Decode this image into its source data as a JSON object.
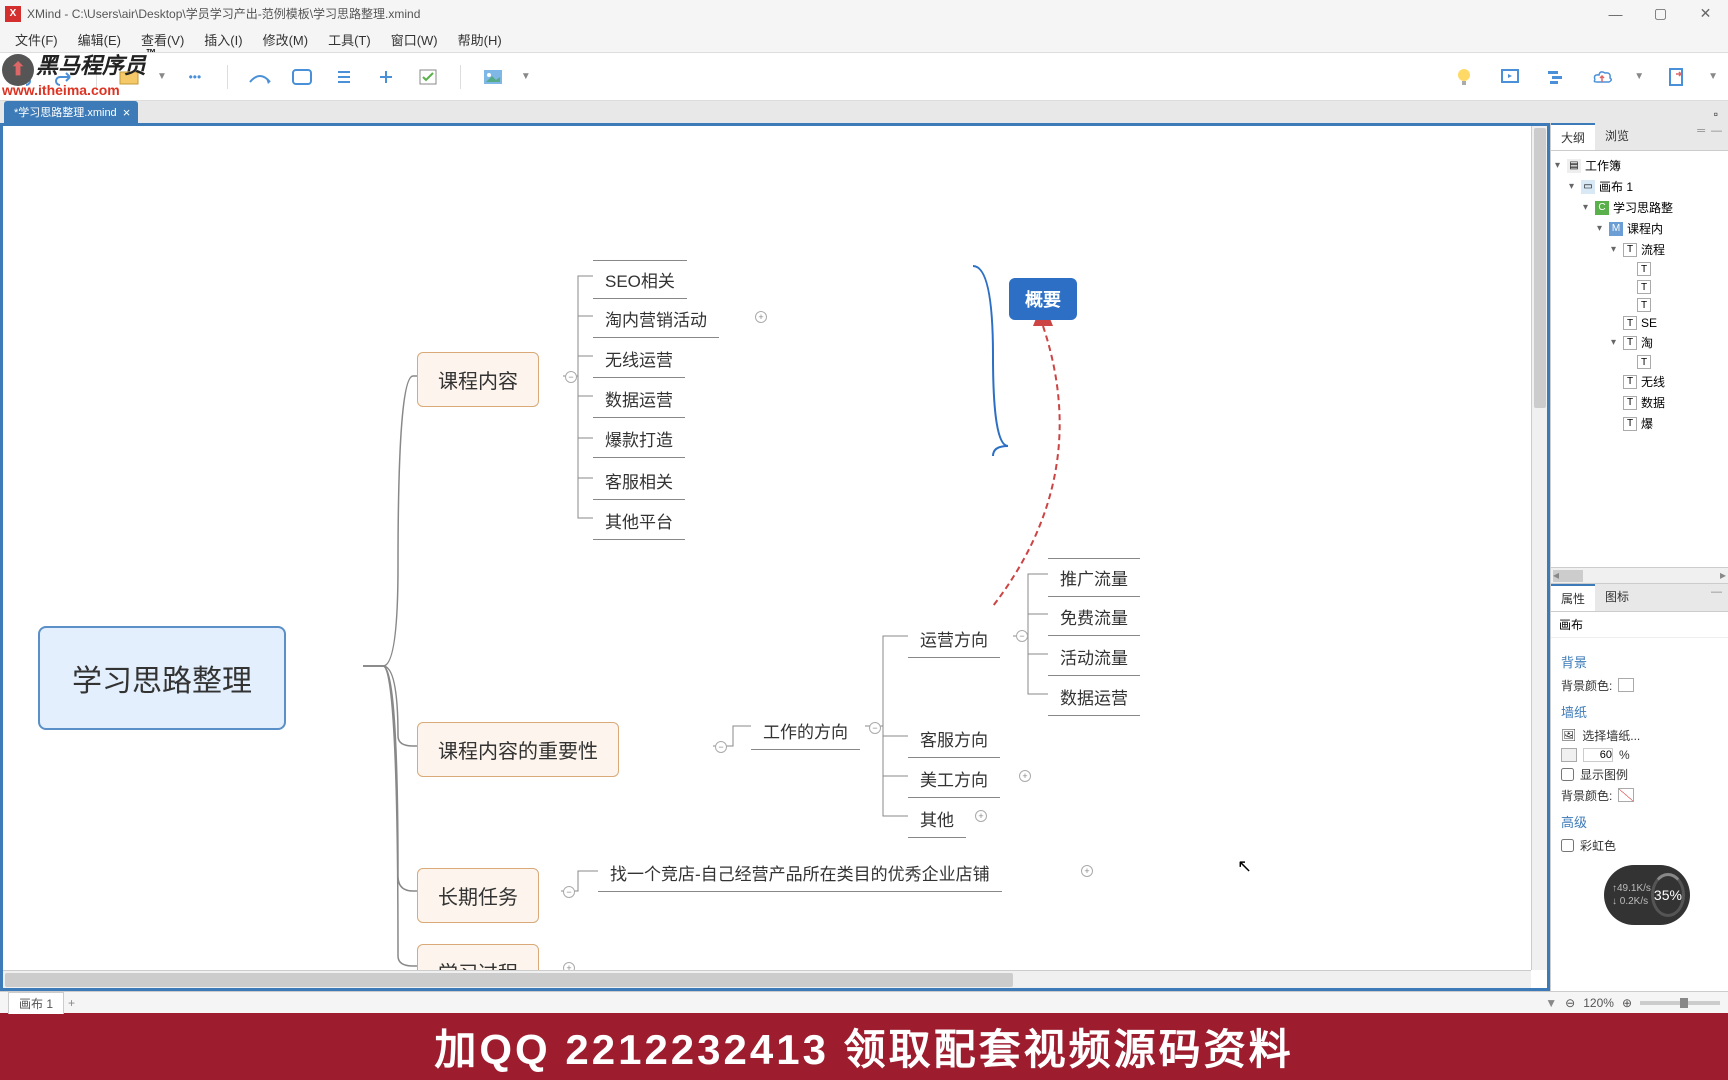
{
  "titlebar": {
    "app": "XMind",
    "path": "C:\\Users\\air\\Desktop\\学员学习产出-范例模板\\学习思路整理.xmind"
  },
  "menubar": [
    "文件(F)",
    "编辑(E)",
    "查看(V)",
    "插入(I)",
    "修改(M)",
    "工具(T)",
    "窗口(W)",
    "帮助(H)"
  ],
  "tab": {
    "label": "*学习思路整理.xmind"
  },
  "logo": {
    "cn": "黑马程序员",
    "url": "www.itheima.com",
    "tm": "™"
  },
  "mindmap": {
    "root": "学习思路整理",
    "summary_label": "概要",
    "topics": {
      "content": {
        "label": "课程内容",
        "children": [
          "SEO相关",
          "淘内营销活动",
          "无线运营",
          "数据运营",
          "爆款打造",
          "客服相关",
          "其他平台"
        ]
      },
      "importance": {
        "label": "课程内容的重要性",
        "work_direction": "工作的方向",
        "dirs": {
          "ops": {
            "label": "运营方向",
            "children": [
              "推广流量",
              "免费流量",
              "活动流量",
              "数据运营"
            ]
          },
          "cs": "客服方向",
          "art": "美工方向",
          "other": "其他"
        }
      },
      "longterm": {
        "label": "长期任务",
        "child": "找一个竞店-自己经营产品所在类目的优秀企业店铺"
      },
      "process": {
        "label": "学习过程"
      }
    }
  },
  "right_panel": {
    "tabs": [
      "大纲",
      "浏览"
    ],
    "tree": {
      "workbook": "工作簿",
      "sheet": "画布 1",
      "root": "学习思路整",
      "course": "课程内",
      "flow": "流程",
      "items": [
        "",
        "",
        "",
        "SE",
        "淘",
        "",
        "无线",
        "数据",
        "爆"
      ]
    },
    "props_tabs": [
      "属性",
      "图标"
    ],
    "props": {
      "canvas_label": "画布",
      "bg_section": "背景",
      "bg_color": "背景颜色:",
      "wallpaper_section": "墙纸",
      "select_wallpaper": "选择墙纸...",
      "opacity_value": "60",
      "opacity_unit": "%",
      "show_legend": "显示图例",
      "bg_color2": "背景颜色:",
      "advanced_section": "高级",
      "rainbow": "彩虹色"
    }
  },
  "statusbar": {
    "sheet": "画布 1",
    "zoom": "120%"
  },
  "speed": {
    "up": "↑49.1K/s",
    "down": "↓ 0.2K/s",
    "pct": "35%"
  },
  "banner": "加QQ 2212232413  领取配套视频源码资料"
}
